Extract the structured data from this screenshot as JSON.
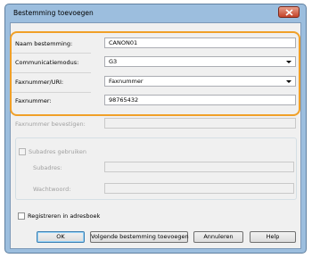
{
  "window": {
    "title": "Bestemming toevoegen"
  },
  "form": {
    "name_label": "Naam bestemming:",
    "name_value": "CANON01",
    "mode_label": "Communicatiemodus:",
    "mode_value": "G3",
    "type_label": "Faxnummer/URI:",
    "type_value": "Faxnummer",
    "number_label": "Faxnummer:",
    "number_value": "98765432",
    "confirm_label": "Faxnummer bevestigen:",
    "confirm_value": ""
  },
  "subaddress": {
    "checkbox_label": "Subadres gebruiken",
    "checked": false,
    "subaddress_label": "Subadres:",
    "password_label": "Wachtwoord:"
  },
  "register": {
    "checkbox_label": "Registreren in adresboek",
    "checked": false
  },
  "buttons": {
    "ok": "OK",
    "next": "Volgende bestemming toevoegen",
    "cancel": "Annuleren",
    "help": "Help"
  },
  "colors": {
    "highlight": "#f0a028",
    "close_button": "#c4432a",
    "frame": "#9cbede"
  }
}
